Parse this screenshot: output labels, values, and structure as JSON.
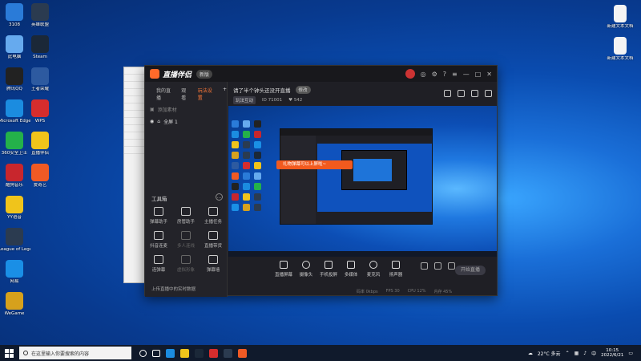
{
  "desktop": {
    "icons": [
      {
        "label": "3108",
        "color": "#2a7bd8"
      },
      {
        "label": "此电脑",
        "color": "#66aaee"
      },
      {
        "label": "腾讯QQ",
        "color": "#222222"
      },
      {
        "label": "Microsoft Edge",
        "color": "#1b8ce0"
      },
      {
        "label": "360安全卫士",
        "color": "#24b14a"
      },
      {
        "label": "酷狗音乐",
        "color": "#c8262d"
      },
      {
        "label": "YY语音",
        "color": "#f0c41b"
      },
      {
        "label": "League of Legends",
        "color": "#2b3b50"
      },
      {
        "label": "网易",
        "color": "#1a8fe6"
      },
      {
        "label": "WeGame",
        "color": "#d6a11c"
      },
      {
        "label": "英雄联盟",
        "color": "#2b3b50"
      },
      {
        "label": "Steam",
        "color": "#1b2838"
      },
      {
        "label": "王者荣耀",
        "color": "#2d5aa0"
      },
      {
        "label": "WPS",
        "color": "#d62d2d"
      },
      {
        "label": "直播伴侣",
        "color": "#f0c41b"
      },
      {
        "label": "爱奇艺",
        "color": "#f05a24"
      }
    ],
    "right_icons": [
      {
        "label": "新建文本文档"
      },
      {
        "label": "新建文本文档"
      }
    ]
  },
  "window": {
    "app_name": "直播伴侣",
    "version": "新版",
    "tabs": [
      "我的直播",
      "观看",
      "玩法设置"
    ],
    "active_tab": "玩法设置",
    "scene_add": "添加素材",
    "scene_item": "全屏 1",
    "toolbox_title": "工具箱",
    "tools": [
      {
        "label": "弹幕助手",
        "dim": false
      },
      {
        "label": "房管助手",
        "dim": false
      },
      {
        "label": "主播任务",
        "dim": false
      },
      {
        "label": "抖音连麦",
        "dim": false
      },
      {
        "label": "多人连线",
        "dim": true
      },
      {
        "label": "直播带货",
        "dim": false
      },
      {
        "label": "连弹幕",
        "dim": false
      },
      {
        "label": "虚拟形象",
        "dim": true
      },
      {
        "label": "弹幕墙",
        "dim": false
      }
    ],
    "help_link": "上传直播中的实时数据",
    "room_title": "请了半个钟头还没开直播",
    "edit_btn": "修改",
    "tag": "玩法互动",
    "meta_id": "ID 71001",
    "meta_fans": "542",
    "banner": "礼物弹幕可以上屏啦~",
    "controls": [
      {
        "label": "直播屏幕"
      },
      {
        "label": "摄像头"
      },
      {
        "label": "手机投屏"
      },
      {
        "label": "多媒体"
      },
      {
        "label": "麦克风"
      },
      {
        "label": "扬声器"
      }
    ],
    "start_btn": "开始直播",
    "status": [
      "码率 0kbps",
      "FPS 30",
      "CPU 12%",
      "内存 45%"
    ]
  },
  "taskbar": {
    "search_placeholder": "在这里输入你要搜索的内容",
    "weather": "22°C 多云",
    "lang": "中",
    "time": "10:15",
    "date": "2022/6/21"
  }
}
